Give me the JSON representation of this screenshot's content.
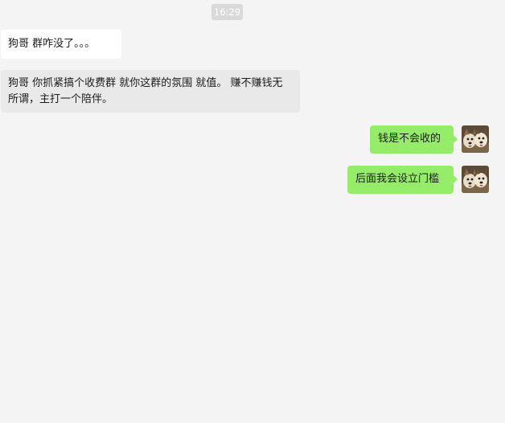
{
  "chat": {
    "timestamp": "16:29",
    "messages": [
      {
        "side": "left",
        "text": "狗哥 群咋没了。。。"
      },
      {
        "side": "left",
        "text": "狗哥 你抓紧搞个收费群 就你这群的氛围 就值。 赚不赚钱无所谓，主打一个陪伴。"
      },
      {
        "side": "right",
        "text": "钱是不会收的"
      },
      {
        "side": "right",
        "text": "后面我会设立门槛"
      }
    ]
  },
  "colors": {
    "background": "#f4f4f4",
    "outgoing_bubble": "#95ec69",
    "incoming_bubble": "#ffffff",
    "incoming_bubble_alt": "#e9e9e9",
    "timestamp_bg": "#d9d9d9"
  },
  "icons": {
    "self_avatar": "dog-photo-avatar"
  }
}
